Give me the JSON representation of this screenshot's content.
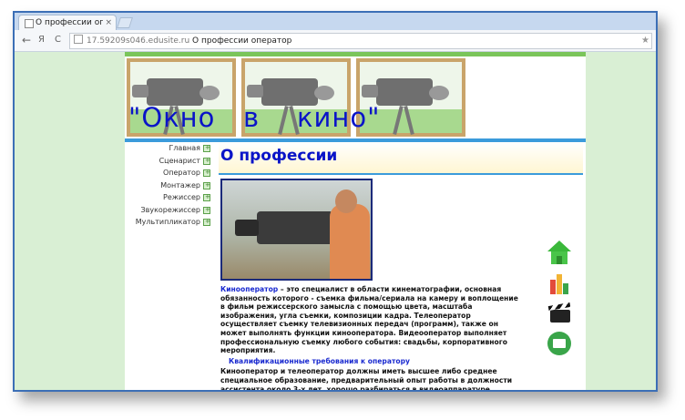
{
  "browser": {
    "tab_title": "О профессии операт",
    "tab_close": "×",
    "url_domain": "17.59209s046.edusite.ru",
    "url_page_title": "О профессии оператор",
    "back": "←",
    "forward": "Я",
    "reload": "C",
    "star": "★"
  },
  "site": {
    "title": "\"Окно   в    кино\""
  },
  "sidebar": {
    "items": [
      {
        "label": "Главная"
      },
      {
        "label": "Сценарист"
      },
      {
        "label": "Оператор"
      },
      {
        "label": "Монтажер"
      },
      {
        "label": "Режиссер"
      },
      {
        "label": "Звукорежиссер"
      },
      {
        "label": "Мультипликатор"
      }
    ]
  },
  "content": {
    "heading": "О профессии",
    "term": "Кинооператор",
    "para1": " – это специалист в области кинематографии, основная обязанность которого - съемка фильма/сериала на камеру и воплощение в фильм режиссерского замысла с помощью цвета, масштаба изображения, угла съемки, композиции кадра. Телеоператор осуществляет съемку телевизионных передач (программ), также он может выполнять функции кинооператора. Видеооператор выполняет профессиональную съемку любого события: свадьбы, корпоративного мероприятия.",
    "subheading": "Квалификационные требования к оператору",
    "para2": "Кинооператор и телеоператор должны иметь высшее либо среднее специальное образование, предварительный опыт работы в должности ассистента около 3-х лет, хорошо разбираться в видеоаппаратуре, работе"
  },
  "icons": [
    "home-icon",
    "chart-icon",
    "clapperboard-icon",
    "mail-icon"
  ]
}
